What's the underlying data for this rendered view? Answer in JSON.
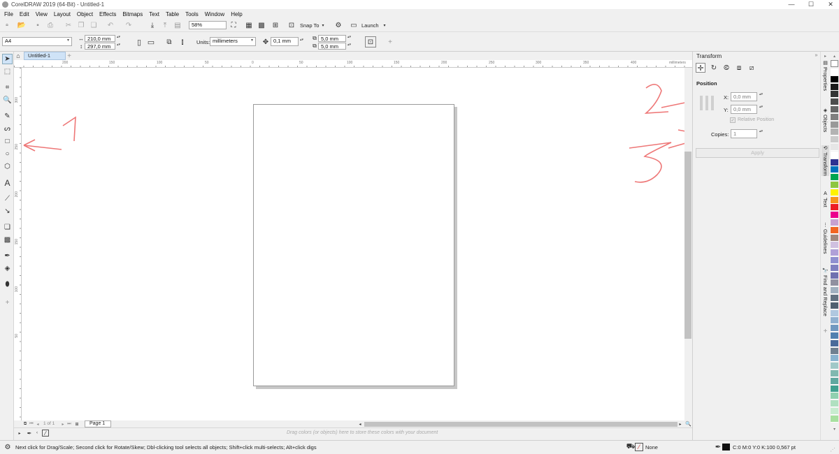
{
  "window": {
    "title": "CorelDRAW 2019 (64-Bit) - Untitled-1",
    "min": "—",
    "max": "☐",
    "close": "✕"
  },
  "menu": [
    "File",
    "Edit",
    "View",
    "Layout",
    "Object",
    "Effects",
    "Bitmaps",
    "Text",
    "Table",
    "Tools",
    "Window",
    "Help"
  ],
  "std_toolbar": {
    "zoom": "58%",
    "snap_to": "Snap To",
    "launch": "Launch"
  },
  "property_bar": {
    "page_size": "A4",
    "width": "210,0 mm",
    "height": "297,0 mm",
    "units_label": "Units:",
    "units": "millimeters",
    "nudge": "0,1 mm",
    "dup_x": "5,0 mm",
    "dup_y": "5,0 mm"
  },
  "doc_tab": "Untitled-1",
  "ruler": {
    "units": "millimeters",
    "h_ticks": [
      "200",
      "150",
      "100",
      "50",
      "0",
      "50",
      "100",
      "150",
      "200",
      "250",
      "300",
      "350",
      "400"
    ],
    "v_ticks": [
      "300",
      "250",
      "200",
      "150",
      "100",
      "50"
    ]
  },
  "page_nav": {
    "of_label": "1 of 1",
    "page_tab": "Page 1"
  },
  "color_bar_hint": "Drag colors (or objects) here to store these colors with your document",
  "docker": {
    "title": "Transform",
    "section": "Position",
    "x_label": "X:",
    "x_value": "0,0 mm",
    "y_label": "Y:",
    "y_value": "0,0 mm",
    "relative": "Relative Position",
    "copies_label": "Copies:",
    "copies_value": "1",
    "apply": "Apply"
  },
  "docker_tabs": [
    "Properties",
    "Objects",
    "Transform",
    "Text",
    "Guidelines",
    "Find and Replace"
  ],
  "status": {
    "hint": "Next click for Drag/Scale; Second click for Rotate/Skew; Dbl-clicking tool selects all objects; Shift+click multi-selects; Alt+click digs",
    "fill": "None",
    "outline": "C:0 M:0 Y:0 K:100  0,567 pt"
  },
  "annotations": [
    "1",
    "2",
    "3"
  ],
  "palette": [
    "#ffffff",
    "#000000",
    "#1a1a1a",
    "#333333",
    "#4d4d4d",
    "#666666",
    "#808080",
    "#999999",
    "#b3b3b3",
    "#cccccc",
    "#e6e6e6",
    "#ffffff",
    "#2e3192",
    "#0072bc",
    "#00a651",
    "#8dc63f",
    "#fff200",
    "#f7941d",
    "#ed1c24",
    "#ec008c",
    "#c8a0d0",
    "#f26522",
    "#a0887e",
    "#d0c0e0",
    "#b0a0d8",
    "#9090d0",
    "#8080c0",
    "#7070b0",
    "#9090a0",
    "#a0b0c0",
    "#607080",
    "#506070",
    "#b0c8e0",
    "#90b0d0",
    "#7098c0",
    "#5080b0",
    "#4a6a9a",
    "#708090",
    "#8ab4d0",
    "#a0c8c8",
    "#80b8b0",
    "#60a8a0",
    "#40a090",
    "#90d0b0",
    "#b0e0c0",
    "#c8ecd0",
    "#a8e0a0"
  ]
}
